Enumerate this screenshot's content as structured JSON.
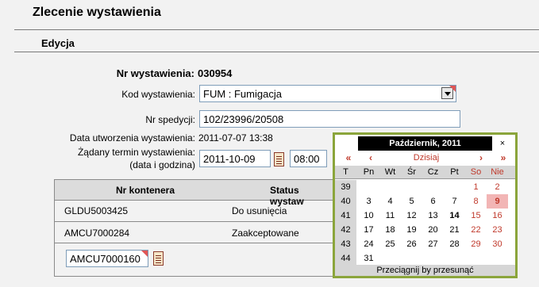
{
  "page": {
    "title": "Zlecenie wystawienia",
    "section": "Edycja"
  },
  "form": {
    "nr_label": "Nr wystawienia:",
    "nr_value": "030954",
    "kod_label": "Kod wystawienia:",
    "kod_value": "FUM : Fumigacja",
    "spedycja_label": "Nr spedycji:",
    "spedycja_value": "102/23996/20508",
    "data_label": "Data utworzenia wystawienia:",
    "data_value": "2011-07-07 13:38",
    "termin_label_1": "Żądany termin wystawienia:",
    "termin_label_2": "(data i godzina)",
    "termin_date": "2011-10-09",
    "termin_time": "08:00"
  },
  "containers": {
    "headers": [
      "Nr kontenera",
      "Status wystaw"
    ],
    "rows": [
      {
        "nr": "GLDU5003425",
        "status": "Do usunięcia"
      },
      {
        "nr": "AMCU7000284",
        "status": "Zaakceptowane"
      }
    ],
    "new_value": "AMCU7000160"
  },
  "calendar": {
    "month_title": "Październik, 2011",
    "close": "×",
    "prev_year": "«",
    "prev_month": "‹",
    "today": "Dzisiaj",
    "next_month": "›",
    "next_year": "»",
    "week_header": "T",
    "day_headers": [
      "Pn",
      "Wt",
      "Śr",
      "Cz",
      "Pt",
      "So",
      "Nie"
    ],
    "weeks": [
      {
        "wk": "39",
        "days": [
          "",
          "",
          "",
          "",
          "",
          "1",
          "2"
        ]
      },
      {
        "wk": "40",
        "days": [
          "3",
          "4",
          "5",
          "6",
          "7",
          "8",
          "9"
        ]
      },
      {
        "wk": "41",
        "days": [
          "10",
          "11",
          "12",
          "13",
          "14",
          "15",
          "16"
        ]
      },
      {
        "wk": "42",
        "days": [
          "17",
          "18",
          "19",
          "20",
          "21",
          "22",
          "23"
        ]
      },
      {
        "wk": "43",
        "days": [
          "24",
          "25",
          "26",
          "27",
          "28",
          "29",
          "30"
        ]
      },
      {
        "wk": "44",
        "days": [
          "31",
          "",
          "",
          "",
          "",
          "",
          ""
        ]
      }
    ],
    "selected_day": "9",
    "today_day": "14",
    "footer": "Przeciągnij by przesunąć"
  },
  "colors": {
    "accent_red": "#c0392b",
    "calendar_border": "#8ba53b",
    "selected_bg": "#f2b5b5"
  }
}
